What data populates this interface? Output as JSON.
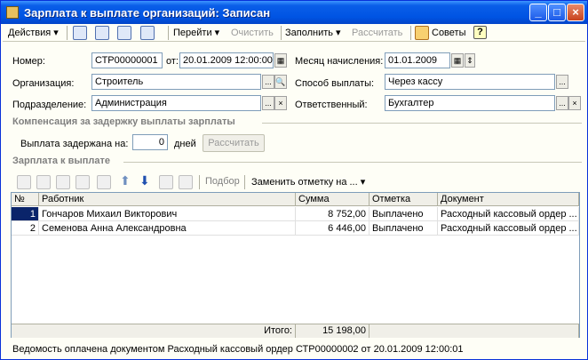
{
  "window": {
    "title": "Зарплата к выплате организаций: Записан",
    "min": "_",
    "max": "□",
    "close": "×"
  },
  "toolbar": {
    "actions": "Действия ▾",
    "goto": "Перейти ▾",
    "clear": "Очистить",
    "fill": "Заполнить ▾",
    "calculate": "Рассчитать",
    "tips": "Советы",
    "help": "?"
  },
  "form": {
    "number_label": "Номер:",
    "number_value": "СТР00000001",
    "from_label": "от:",
    "date_value": "20.01.2009 12:00:00",
    "month_label": "Месяц начисления:",
    "month_value": "01.01.2009",
    "org_label": "Организация:",
    "org_value": "Строитель",
    "pay_method_label": "Способ выплаты:",
    "pay_method_value": "Через кассу",
    "dept_label": "Подразделение:",
    "dept_value": "Администрация",
    "responsible_label": "Ответственный:",
    "responsible_value": "Бухгалтер",
    "ellipsis": "...",
    "clear_x": "×"
  },
  "compensation": {
    "title": "Компенсация за задержку выплаты зарплаты",
    "delay_label": "Выплата задержана на:",
    "delay_value": "0",
    "days_label": "дней",
    "calc_button": "Рассчитать"
  },
  "payout": {
    "title": "Зарплата к выплате",
    "select": "Подбор",
    "replace_mark": "Заменить отметку на ... ▾",
    "columns": [
      "№",
      "Работник",
      "Сумма",
      "Отметка",
      "Документ"
    ],
    "rows": [
      {
        "n": "1",
        "employee": "Гончаров Михаил Викторович",
        "sum": "8 752,00",
        "mark": "Выплачено",
        "doc": "Расходный кассовый ордер ..."
      },
      {
        "n": "2",
        "employee": "Семенова Анна Александровна",
        "sum": "6 446,00",
        "mark": "Выплачено",
        "doc": "Расходный кассовый ордер ..."
      }
    ],
    "total_label": "Итого:",
    "total_value": "15 198,00"
  },
  "status": {
    "text": "Ведомость оплачена документом Расходный кассовый ордер СТР00000002 от 20.01.2009 12:00:01"
  }
}
